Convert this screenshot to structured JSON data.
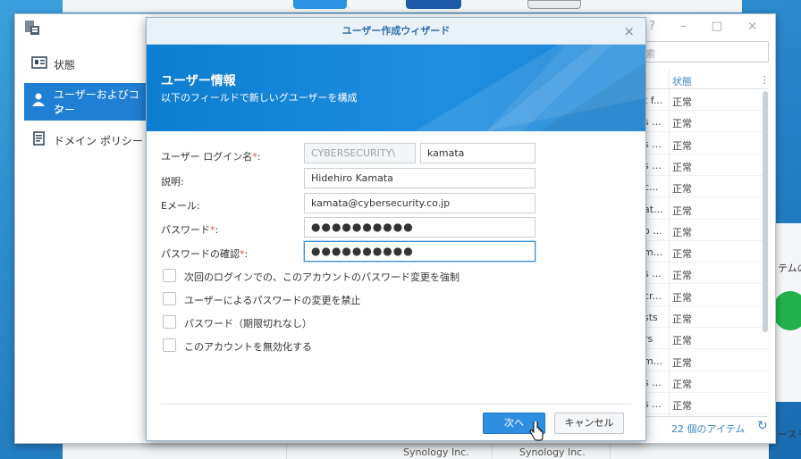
{
  "background": {
    "bottom_bar": [
      "Synology Inc.",
      "Synology Inc."
    ],
    "right_edge_texts": [
      "テムの",
      "ースモ"
    ]
  },
  "control_panel": {
    "sidebar": [
      {
        "label": "状態"
      },
      {
        "label_line1": "ユーザーおよびコン",
        "label_line2": "ター"
      },
      {
        "label": "ドメイン ポリシー"
      }
    ],
    "window_controls": "? – □ ×",
    "search_placeholder": "索",
    "grid": {
      "header_status": "状態",
      "header_menu": "⋮",
      "rows": [
        {
          "c1": "t f...",
          "status": "正常"
        },
        {
          "c1": "s ...",
          "status": "正常"
        },
        {
          "c1": "s ...",
          "status": "正常"
        },
        {
          "c1": "s ...",
          "status": "正常"
        },
        {
          "c1": "c...",
          "status": "正常"
        },
        {
          "c1": "at...",
          "status": "正常"
        },
        {
          "c1": "o ...",
          "status": "正常"
        },
        {
          "c1": "m...",
          "status": "正常"
        },
        {
          "c1": "s ...",
          "status": "正常"
        },
        {
          "c1": "cr...",
          "status": "正常"
        },
        {
          "c1": "sts",
          "status": "正常"
        },
        {
          "c1": "rs",
          "status": "正常"
        },
        {
          "c1": "m...",
          "status": "正常"
        },
        {
          "c1": "s ...",
          "status": "正常"
        },
        {
          "c1": "s ...",
          "status": "正常"
        }
      ],
      "footer_count": "22 個のアイテム",
      "refresh_icon": "↻"
    }
  },
  "wizard": {
    "title": "ユーザー作成ウィザード",
    "close": "×",
    "banner_title": "ユーザー情報",
    "banner_subtitle": "以下のフィールドで新しいグユーザーを構成",
    "fields": {
      "login_label": "ユーザー ログイン名",
      "required_mark": "*",
      "colon": ":",
      "domain_value": "CYBERSECURITY\\",
      "login_value": "kamata",
      "description_label": "説明:",
      "description_value": "Hidehiro Kamata",
      "email_label": "Eメール:",
      "email_value": "kamata@cybersecurity.co.jp",
      "password_label": "パスワード",
      "password_value": "●●●●●●●●●●",
      "confirm_label": "パスワードの確認",
      "confirm_value": "●●●●●●●●●●"
    },
    "checkboxes": [
      {
        "label": "次回のログインでの、このアカウントのパスワード変更を強制",
        "checked": false
      },
      {
        "label": "ユーザーによるパスワードの変更を禁止",
        "checked": false
      },
      {
        "label": "パスワード（期限切れなし）",
        "checked": false
      },
      {
        "label": "このアカウントを無効化する",
        "checked": false
      }
    ],
    "buttons": {
      "next": "次へ",
      "cancel": "キャンセル"
    }
  }
}
